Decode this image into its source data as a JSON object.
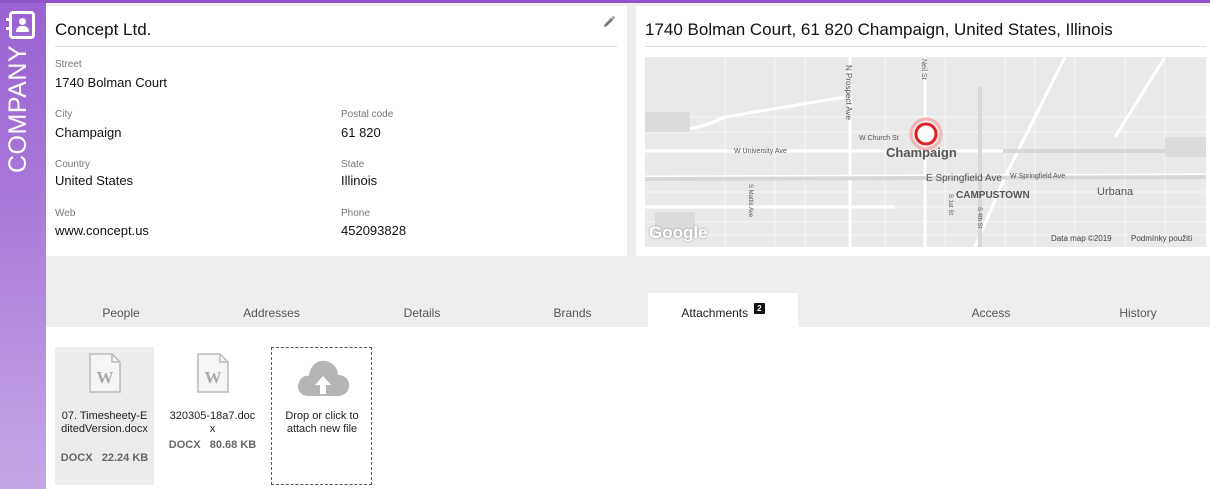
{
  "rail": {
    "label": "COMPANY",
    "icon": "contact-book-icon",
    "color": "#9a62d2"
  },
  "info": {
    "title": "Concept Ltd.",
    "fields": {
      "street_label": "Street",
      "street": "1740  Bolman Court",
      "city_label": "City",
      "city": "Champaign",
      "postal_label": "Postal code",
      "postal": "61 820",
      "country_label": "Country",
      "country": "United States",
      "state_label": "State",
      "state": "Illinois",
      "web_label": "Web",
      "web": "www.concept.us",
      "phone_label": "Phone",
      "phone": "452093828"
    }
  },
  "map": {
    "title": "1740 Bolman Court, 61 820 Champaign, United States, Illinois",
    "labels": {
      "prospect": "N Prospect Ave",
      "neil": "Neil St",
      "church": "W Church St",
      "university": "W University Ave",
      "champaign": "Champaign",
      "springfield_e": "E Springfield Ave",
      "springfield_w": "W Springfield Ave",
      "campustown": "CAMPUSTOWN",
      "urbana": "Urbana",
      "mattis": "S Mattis Ave",
      "first": "S 1st St",
      "fourth": "S 4th St",
      "google": "Google",
      "data": "Data map ©2019",
      "terms": "Podmínky použití"
    }
  },
  "tabs": [
    {
      "label": "People"
    },
    {
      "label": "Addresses"
    },
    {
      "label": "Details"
    },
    {
      "label": "Brands"
    },
    {
      "label": "Attachments",
      "badge": "2",
      "active": true
    },
    {
      "label": ""
    },
    {
      "label": "Access"
    },
    {
      "label": "History"
    }
  ],
  "attachments": {
    "files": [
      {
        "name": "07. Timesheety-EditedVersion.docx",
        "type": "DOCX",
        "size": "22.24 KB"
      },
      {
        "name": "320305-18a7.docx",
        "type": "DOCX",
        "size": "80.68 KB"
      }
    ],
    "drop_text": "Drop or click to attach new file",
    "doc_glyph": "W"
  }
}
